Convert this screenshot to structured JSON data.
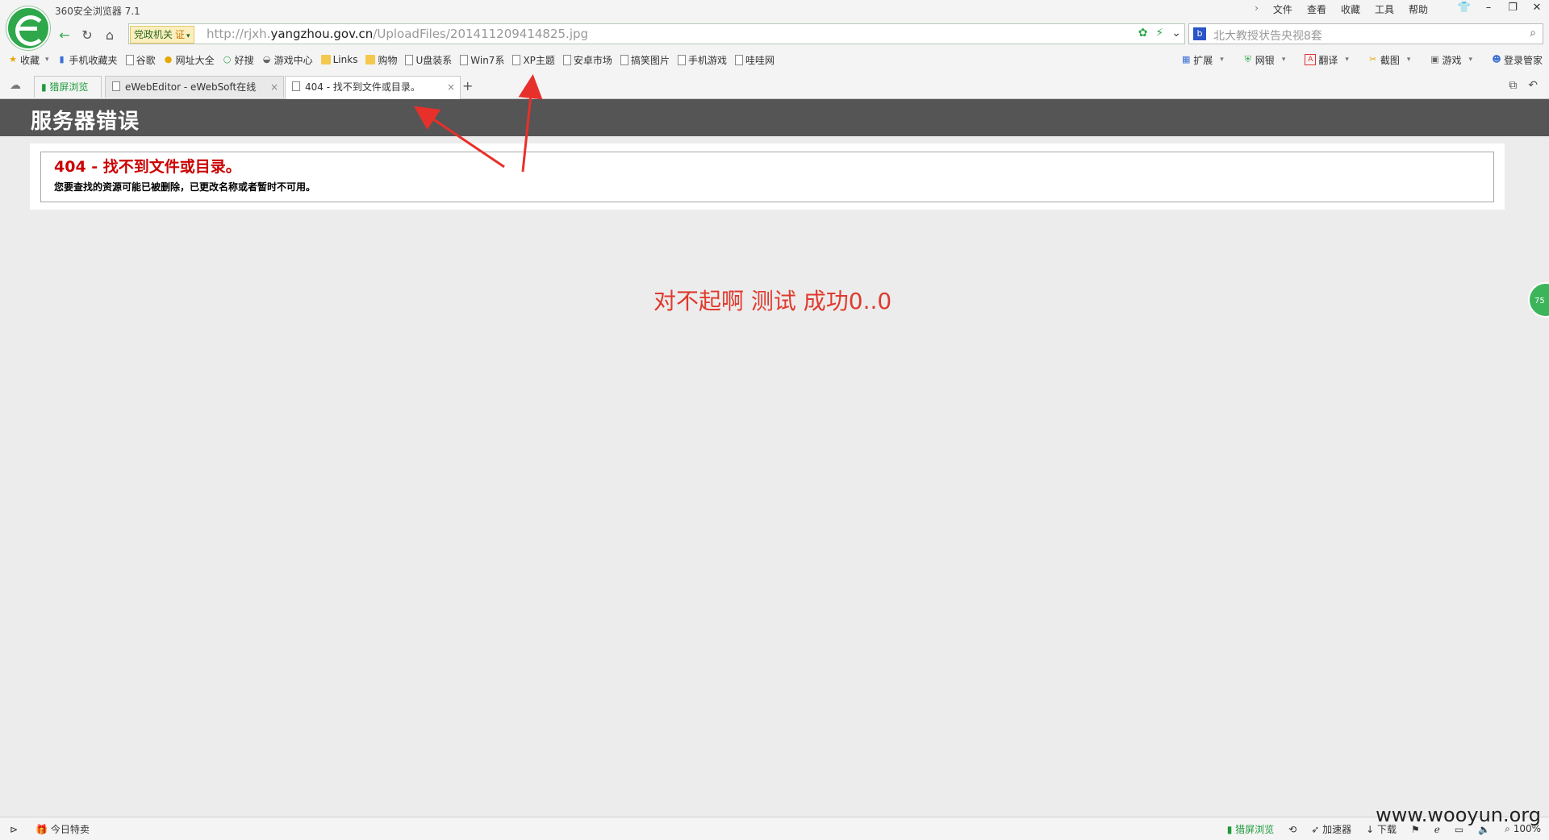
{
  "browser": {
    "title": "360安全浏览器 7.1",
    "menu": [
      "文件",
      "查看",
      "收藏",
      "工具",
      "帮助"
    ],
    "address": {
      "badge": "党政机关",
      "badge_cert": "证",
      "url_prefix": "http://rjxh.",
      "url_host": "yangzhou.gov.cn",
      "url_path": "/UploadFiles/201411209414825.jpg"
    },
    "search": {
      "placeholder": "北大教授状告央视8套"
    },
    "bookmarks": [
      {
        "label": "收藏",
        "icon": "star-icon"
      },
      {
        "label": "手机收藏夹",
        "icon": "phone-icon"
      },
      {
        "label": "谷歌",
        "icon": "page-icon"
      },
      {
        "label": "网址大全",
        "icon": "globe-icon"
      },
      {
        "label": "好搜",
        "icon": "search-icon"
      },
      {
        "label": "游戏中心",
        "icon": "gamepad-icon"
      },
      {
        "label": "Links",
        "icon": "folder-icon"
      },
      {
        "label": "购物",
        "icon": "folder-icon"
      },
      {
        "label": "U盘装系",
        "icon": "page-icon"
      },
      {
        "label": "Win7系",
        "icon": "page-icon"
      },
      {
        "label": "XP主题",
        "icon": "page-icon"
      },
      {
        "label": "安卓市场",
        "icon": "page-icon"
      },
      {
        "label": "搞笑图片",
        "icon": "page-icon"
      },
      {
        "label": "手机游戏",
        "icon": "page-icon"
      },
      {
        "label": "哇哇网",
        "icon": "page-icon"
      }
    ],
    "bookmarks_right": [
      "扩展",
      "网银",
      "翻译",
      "截图",
      "游戏",
      "登录管家"
    ],
    "tabs": {
      "split": "猎屏浏览",
      "tab1": "eWebEditor - eWebSoft在线",
      "tab2": "404 - 找不到文件或目录。"
    }
  },
  "page": {
    "header": "服务器错误",
    "error_title": "404 - 找不到文件或目录。",
    "error_desc": "您要查找的资源可能已被删除，已更改名称或者暂时不可用。",
    "overlay": "对不起啊  测试 成功0..0"
  },
  "status": {
    "left_item": "今日特卖",
    "right_items": [
      "猎屏浏览",
      "加速器",
      "下载",
      "100%"
    ]
  },
  "side_bubble": "75",
  "watermark": "www.wooyun.org",
  "colors": {
    "accent": "#2ea84a",
    "error": "#cc0000",
    "overlay_text": "#e03a2e",
    "header_bg": "#555555",
    "arrow": "#e8302a"
  }
}
